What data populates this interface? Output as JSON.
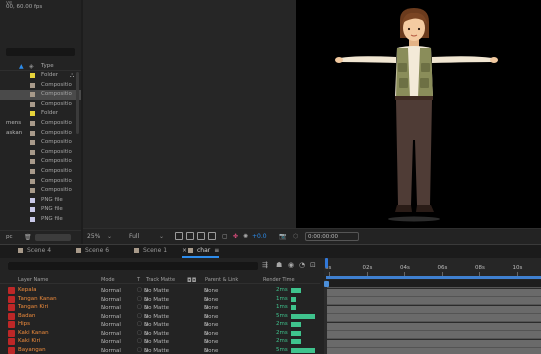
{
  "project": {
    "info": "00, 60.00 fps",
    "dim_fragment": "ve",
    "column_type": "Type",
    "items": [
      {
        "name": "",
        "swatch": "#e7d33a",
        "type": "Folder",
        "flow": true,
        "selected": false
      },
      {
        "name": "",
        "swatch": "#a89a8a",
        "type": "Compositio",
        "flow": false,
        "selected": false
      },
      {
        "name": "",
        "swatch": "#a89a8a",
        "type": "Compositio",
        "flow": false,
        "selected": true
      },
      {
        "name": "",
        "swatch": "#a89a8a",
        "type": "Compositio",
        "flow": false,
        "selected": false
      },
      {
        "name": "",
        "swatch": "#e7d33a",
        "type": "Folder",
        "flow": false,
        "selected": false
      },
      {
        "name": "mens",
        "swatch": "#a89a8a",
        "type": "Compositio",
        "flow": false,
        "selected": false
      },
      {
        "name": "askan",
        "swatch": "#a89a8a",
        "type": "Compositio",
        "flow": false,
        "selected": false
      },
      {
        "name": "",
        "swatch": "#a89a8a",
        "type": "Compositio",
        "flow": false,
        "selected": false
      },
      {
        "name": "",
        "swatch": "#a89a8a",
        "type": "Compositio",
        "flow": false,
        "selected": false
      },
      {
        "name": "",
        "swatch": "#a89a8a",
        "type": "Compositio",
        "flow": false,
        "selected": false
      },
      {
        "name": "",
        "swatch": "#a89a8a",
        "type": "Compositio",
        "flow": false,
        "selected": false
      },
      {
        "name": "",
        "swatch": "#a89a8a",
        "type": "Compositio",
        "flow": false,
        "selected": false
      },
      {
        "name": "",
        "swatch": "#a89a8a",
        "type": "Compositio",
        "flow": false,
        "selected": false
      },
      {
        "name": "",
        "swatch": "#c8c8e8",
        "type": "PNG file",
        "flow": false,
        "selected": false
      },
      {
        "name": "",
        "swatch": "#c8c8e8",
        "type": "PNG file",
        "flow": false,
        "selected": false
      },
      {
        "name": "",
        "swatch": "#c8c8e8",
        "type": "PNG file",
        "flow": false,
        "selected": false
      }
    ],
    "footer_label": "pc"
  },
  "viewer_bar": {
    "zoom": "25%",
    "resolution": "Full",
    "exposure": "+0.0",
    "timecode": "0:00:00:00"
  },
  "tabs": [
    {
      "label": "Scene 4",
      "active": false
    },
    {
      "label": "Scene 6",
      "active": false
    },
    {
      "label": "Scene 1",
      "active": false
    },
    {
      "label": "char",
      "active": true
    }
  ],
  "timeline": {
    "columns": {
      "layer_name": "Layer Name",
      "mode": "Mode",
      "t": "T",
      "track_matte": "Track Matte",
      "parent_link": "Parent & Link",
      "render_time": "Render Time"
    },
    "ruler_labels": [
      "0s",
      "02s",
      "04s",
      "06s",
      "08s",
      "10s"
    ],
    "layers": [
      {
        "id": "",
        "name": "Kepala",
        "mode": "Normal",
        "matte": "No Matte",
        "parent": "None",
        "render": "2ms",
        "render_fraction": 0.4
      },
      {
        "id": "",
        "name": "Tangan Kanan",
        "mode": "Normal",
        "matte": "No Matte",
        "parent": "None",
        "render": "1ms",
        "render_fraction": 0.2
      },
      {
        "id": "",
        "name": "Tangan Kiri",
        "mode": "Normal",
        "matte": "No Matte",
        "parent": "None",
        "render": "1ms",
        "render_fraction": 0.2
      },
      {
        "id": "",
        "name": "Badan",
        "mode": "Normal",
        "matte": "No Matte",
        "parent": "None",
        "render": "5ms",
        "render_fraction": 1.0
      },
      {
        "id": "",
        "name": "Hips",
        "mode": "Normal",
        "matte": "No Matte",
        "parent": "None",
        "render": "2ms",
        "render_fraction": 0.4
      },
      {
        "id": "",
        "name": "Kaki Kanan",
        "mode": "Normal",
        "matte": "No Matte",
        "parent": "None",
        "render": "2ms",
        "render_fraction": 0.4
      },
      {
        "id": "",
        "name": "Kaki Kiri",
        "mode": "Normal",
        "matte": "No Matte",
        "parent": "None",
        "render": "2ms",
        "render_fraction": 0.4
      },
      {
        "id": "",
        "name": "Bayangan",
        "mode": "Normal",
        "matte": "No Matte",
        "parent": "None",
        "render": "5ms",
        "render_fraction": 1.0
      }
    ]
  }
}
